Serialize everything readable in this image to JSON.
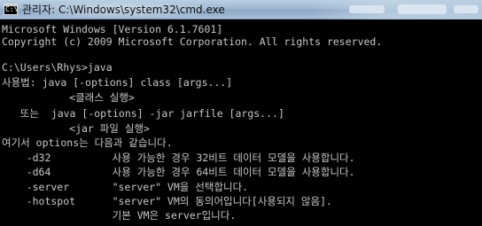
{
  "window": {
    "title": "관리자: C:\\Windows\\system32\\cmd.exe",
    "icon_text": "C:\\"
  },
  "console": {
    "lines": [
      "Microsoft Windows [Version 6.1.7601]",
      "Copyright (c) 2009 Microsoft Corporation. All rights reserved.",
      "",
      "C:\\Users\\Rhys>java",
      "사용법: java [-options] class [args...]",
      "           <클래스 실행>",
      "   또는  java [-options] -jar jarfile [args...]",
      "           <jar 파일 실행>",
      "여기서 options는 다음과 같습니다.",
      "    -d32          사용 가능한 경우 32비트 데이터 모델을 사용합니다.",
      "    -d64          사용 가능한 경우 64비트 데이터 모델을 사용합니다.",
      "    -server       \"server\" VM을 선택합니다.",
      "    -hotspot      \"server\" VM의 동의어입니다[사용되지 않음].",
      "                  기본 VM은 server입니다."
    ]
  },
  "colors": {
    "console_background": "#000000",
    "console_text": "#c0c0c0",
    "titlebar": "#9fb9d3"
  }
}
